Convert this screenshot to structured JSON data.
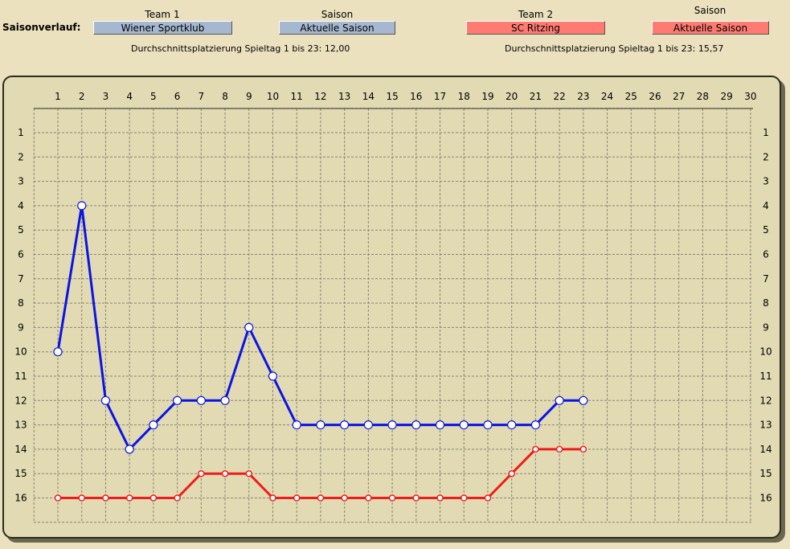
{
  "header": {
    "saisonverlauf_label": "Saisonverlauf:",
    "team1_label": "Team 1",
    "team1_value": "Wiener Sportklub",
    "saison1_label": "Saison",
    "saison1_value": "Aktuelle Saison",
    "team2_label": "Team 2",
    "team2_value": "SC Ritzing",
    "saison2_label": "Saison",
    "saison2_value": "Aktuelle Saison",
    "avg1": "Durchschnittsplatzierung Spieltag 1 bis 23: 12,00",
    "avg2": "Durchschnittsplatzierung Spieltag 1 bis 23: 15,57"
  },
  "colors": {
    "team1": "#0a14e6",
    "team2": "#ee1c1c",
    "team1_button": "#a6b8cf",
    "team2_button": "#ff7b72"
  },
  "chart_data": {
    "type": "line",
    "title": "",
    "xlabel": "",
    "ylabel": "",
    "x": [
      1,
      2,
      3,
      4,
      5,
      6,
      7,
      8,
      9,
      10,
      11,
      12,
      13,
      14,
      15,
      16,
      17,
      18,
      19,
      20,
      21,
      22,
      23,
      24,
      25,
      26,
      27,
      28,
      29,
      30
    ],
    "xlim": [
      1,
      30
    ],
    "ylim": [
      1,
      16
    ],
    "y_inverted": true,
    "y_ticks": [
      1,
      2,
      3,
      4,
      5,
      6,
      7,
      8,
      9,
      10,
      11,
      12,
      13,
      14,
      15,
      16
    ],
    "y_ticks_both_sides": true,
    "x_ticks_position": "top",
    "grid": true,
    "series": [
      {
        "name": "Wiener Sportklub",
        "color": "#0a14e6",
        "marker": "large-circle",
        "x": [
          1,
          2,
          3,
          4,
          5,
          6,
          7,
          8,
          9,
          10,
          11,
          12,
          13,
          14,
          15,
          16,
          17,
          18,
          19,
          20,
          21,
          22,
          23
        ],
        "values": [
          10,
          4,
          12,
          14,
          13,
          12,
          12,
          12,
          9,
          11,
          13,
          13,
          13,
          13,
          13,
          13,
          13,
          13,
          13,
          13,
          13,
          12,
          12
        ]
      },
      {
        "name": "SC Ritzing",
        "color": "#ee1c1c",
        "marker": "small-circle",
        "x": [
          1,
          2,
          3,
          4,
          5,
          6,
          7,
          8,
          9,
          10,
          11,
          12,
          13,
          14,
          15,
          16,
          17,
          18,
          19,
          20,
          21,
          22,
          23
        ],
        "values": [
          16,
          16,
          16,
          16,
          16,
          16,
          15,
          15,
          15,
          16,
          16,
          16,
          16,
          16,
          16,
          16,
          16,
          16,
          16,
          15,
          14,
          14,
          14
        ]
      }
    ]
  }
}
